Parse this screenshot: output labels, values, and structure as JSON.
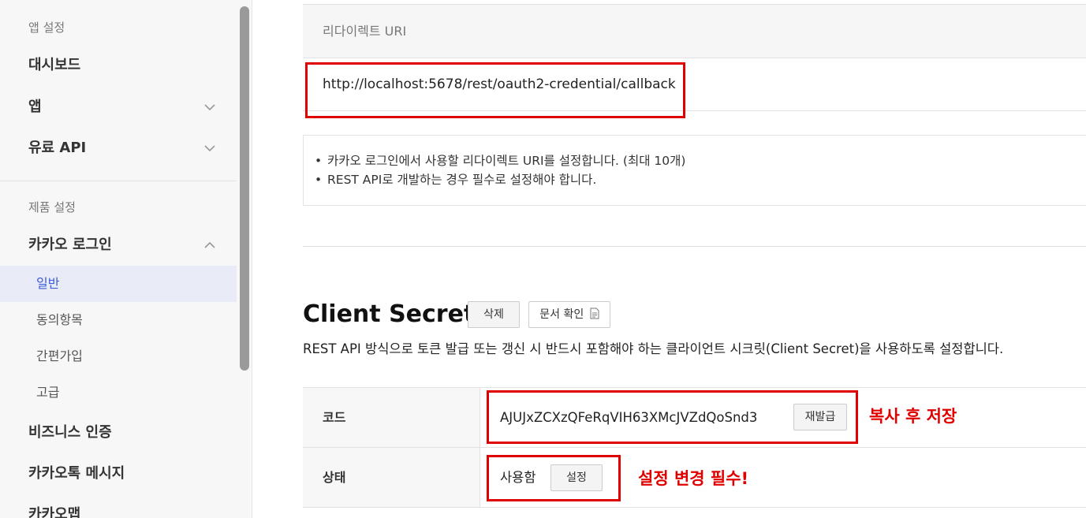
{
  "sidebar": {
    "section_app": "앱 설정",
    "dashboard": "대시보드",
    "app": "앱",
    "paid_api": "유료 API",
    "section_product": "제품 설정",
    "kakao_login": "카카오 로그인",
    "sub_items": [
      "일반",
      "동의항목",
      "간편가입",
      "고급"
    ],
    "biz_auth": "비즈니스 인증",
    "kakaotalk_message": "카카오톡 메시지",
    "kakao_map": "카카오맵"
  },
  "redirect": {
    "header": "리다이렉트 URI",
    "uri": "http://localhost:5678/rest/oauth2-credential/callback",
    "notes": [
      "카카오 로그인에서 사용할 리다이렉트 URI를 설정합니다. (최대 10개)",
      "REST API로 개발하는 경우 필수로 설정해야 합니다."
    ]
  },
  "client_secret": {
    "title": "Client Secret",
    "delete_label": "삭제",
    "docs_label": "문서 확인",
    "description": "REST API 방식으로 토큰 발급 또는 갱신 시 반드시 포함해야 하는 클라이언트 시크릿(Client Secret)을 사용하도록 설정합니다.",
    "code_label": "코드",
    "code_value": "AJUJxZCXzQFeRqVIH63XMcJVZdQoSnd3",
    "reissue_label": "재발급",
    "status_label": "상태",
    "status_value": "사용함",
    "setting_label": "설정"
  },
  "annotations": {
    "copy_save": "복사 후 저장",
    "change_required": "설정 변경 필수!"
  },
  "colors": {
    "accent": "#3d5bd9",
    "annotation_red": "#e00000"
  }
}
